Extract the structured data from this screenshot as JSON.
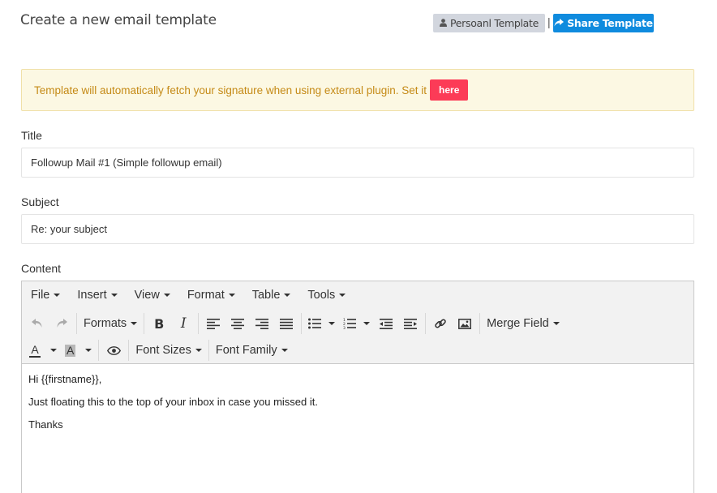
{
  "page": {
    "title": "Create a new email template"
  },
  "header_buttons": {
    "personal_label": "Persoanl Template",
    "separator": "|",
    "share_label": "Share Template"
  },
  "alert": {
    "text": "Template will automatically fetch your signature when using external plugin. Set it",
    "button_label": "here"
  },
  "form": {
    "title_label": "Title",
    "title_value": "Followup Mail #1 (Simple followup email)",
    "subject_label": "Subject",
    "subject_value": "Re: your subject",
    "content_label": "Content"
  },
  "editor": {
    "menu": [
      "File",
      "Insert",
      "View",
      "Format",
      "Table",
      "Tools"
    ],
    "formats_label": "Formats",
    "bold_label": "B",
    "italic_label": "I",
    "merge_field_label": "Merge Field",
    "text_color_label": "A",
    "bg_color_label": "A",
    "font_sizes_label": "Font Sizes",
    "font_family_label": "Font Family",
    "body": [
      "Hi {{firstname}},",
      "Just floating this to the top of your inbox in case you missed it.",
      "Thanks"
    ]
  },
  "colors": {
    "share_button": "#0f8bde",
    "here_button": "#fc3b57",
    "alert_bg": "#fcf8e3",
    "alert_text": "#c58a16"
  }
}
